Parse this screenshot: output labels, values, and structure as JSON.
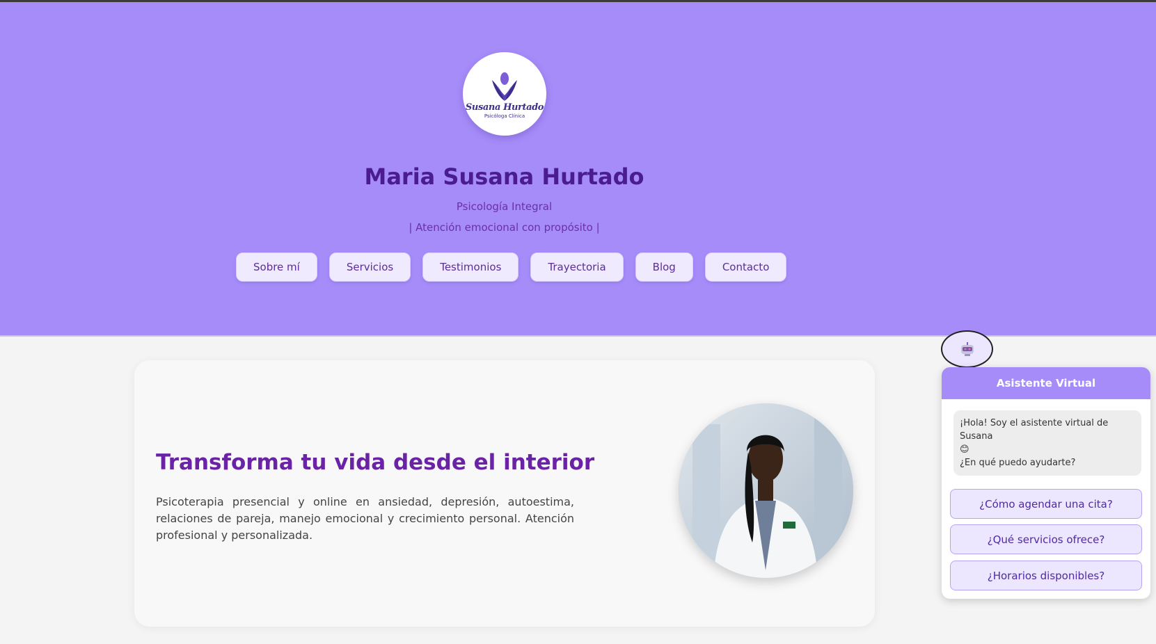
{
  "header": {
    "logo_name": "Susana Hurtado",
    "logo_subtitle": "Psicóloga Clínica",
    "title": "Maria Susana Hurtado",
    "subtitle": "Psicología Integral",
    "tagline": "| Atención emocional con propósito |"
  },
  "nav": {
    "items": [
      {
        "label": "Sobre mí"
      },
      {
        "label": "Servicios"
      },
      {
        "label": "Testimonios"
      },
      {
        "label": "Trayectoria"
      },
      {
        "label": "Blog"
      },
      {
        "label": "Contacto"
      }
    ]
  },
  "hero_card": {
    "heading": "Transforma tu vida desde el interior",
    "text": "Psicoterapia presencial y online en ansiedad, depresión, autoestima, relaciones de pareja, manejo emocional y crecimiento personal. Atención profesional y personalizada."
  },
  "chatbot": {
    "toggle_icon": "robot-icon",
    "title": "Asistente Virtual",
    "greeting_line1": "¡Hola! Soy el asistente virtual de Susana",
    "greeting_emoji": "😊",
    "greeting_line2": "¿En qué puedo ayudarte?",
    "options": [
      {
        "label": "¿Cómo agendar una cita?"
      },
      {
        "label": "¿Qué servicios ofrece?"
      },
      {
        "label": "¿Horarios disponibles?"
      }
    ]
  },
  "colors": {
    "header_bg": "#a68cf9",
    "title": "#4a1c8f",
    "accent": "#6a23a5",
    "button_bg": "#efeafe"
  }
}
